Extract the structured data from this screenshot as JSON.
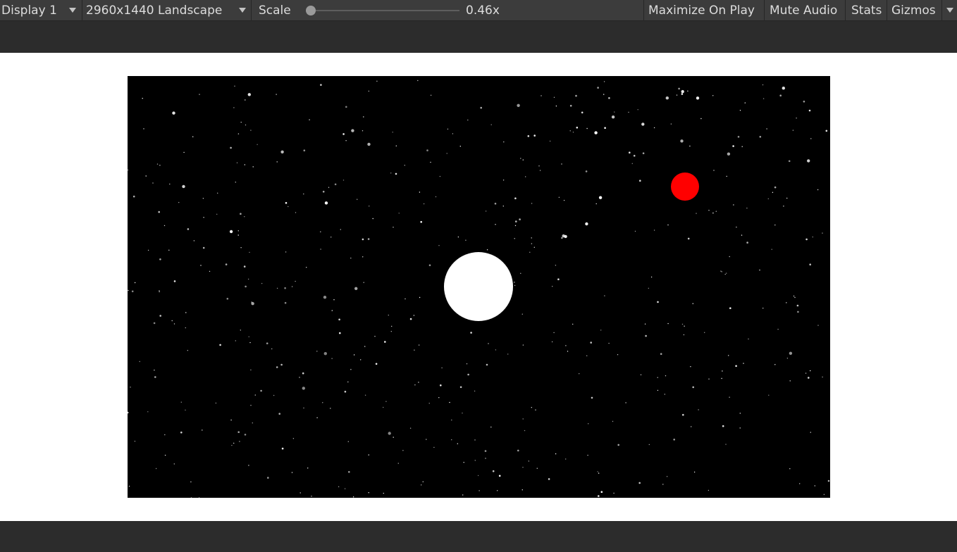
{
  "toolbar": {
    "display": "Display 1",
    "resolution": "2960x1440 Landscape",
    "scale_label": "Scale",
    "scale_value": "0.46x",
    "scale_fraction": 0.03,
    "maximize_on_play": "Maximize On Play",
    "mute_audio": "Mute Audio",
    "stats": "Stats",
    "gizmos": "Gizmos",
    "icons": [
      "dropdown-caret-icon",
      "slider-thumb-icon"
    ]
  },
  "scene": {
    "background_color": "#000000",
    "planet_color": "#ffffff",
    "moon_color": "#ff0000",
    "star_color": "#ffffff"
  }
}
